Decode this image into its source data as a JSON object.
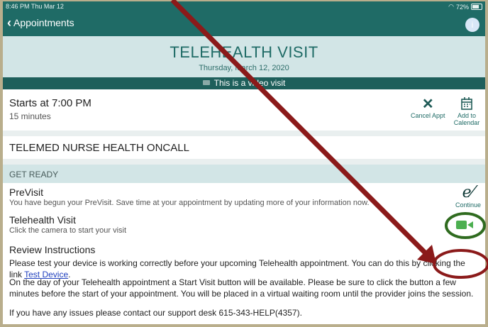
{
  "status": {
    "time": "8:46 PM  Thu Mar 12",
    "battery": "72%"
  },
  "nav": {
    "back_label": "Appointments",
    "info_label": "i"
  },
  "header": {
    "title": "TELEHEALTH VISIT",
    "date": "Thursday, March 12, 2020"
  },
  "video_banner": "This is a video visit",
  "appointment": {
    "starts": "Starts at 7:00 PM",
    "duration": "15 minutes",
    "cancel_label": "Cancel Appt",
    "add_calendar_label": "Add to Calendar",
    "provider": "TELEMED NURSE HEALTH ONCALL"
  },
  "get_ready": {
    "heading": "GET READY",
    "previsit_title": "PreVisit",
    "previsit_sub": "You have begun your PreVisit. Save time at your appointment by updating more of your information now.",
    "continue_label": "Continue",
    "telehealth_title": "Telehealth Visit",
    "telehealth_sub": "Click the camera to start your visit",
    "review_title": "Review Instructions",
    "instr1_pre": "Please test your device is working correctly before your upcoming Telehealth appointment.  You can do this by clicking the link ",
    "instr1_link": "Test Device",
    "instr1_post": ".",
    "instr2": "On the day of your Telehealth appointment a Start Visit button will be available.  Please be sure to click the button a few minutes before the start of your appointment.  You will be placed in a virtual waiting room until the provider joins the session.",
    "instr3": "If you have any issues please contact our support desk 615-343-HELP(4357)."
  },
  "colors": {
    "brand": "#1f6b66",
    "arrow": "#8b1a1a",
    "camera_circle": "#2f6b1f"
  },
  "icons": [
    "chevron-left-icon",
    "info-icon",
    "video-icon",
    "close-icon",
    "calendar-icon",
    "signature-icon",
    "camera-icon"
  ]
}
